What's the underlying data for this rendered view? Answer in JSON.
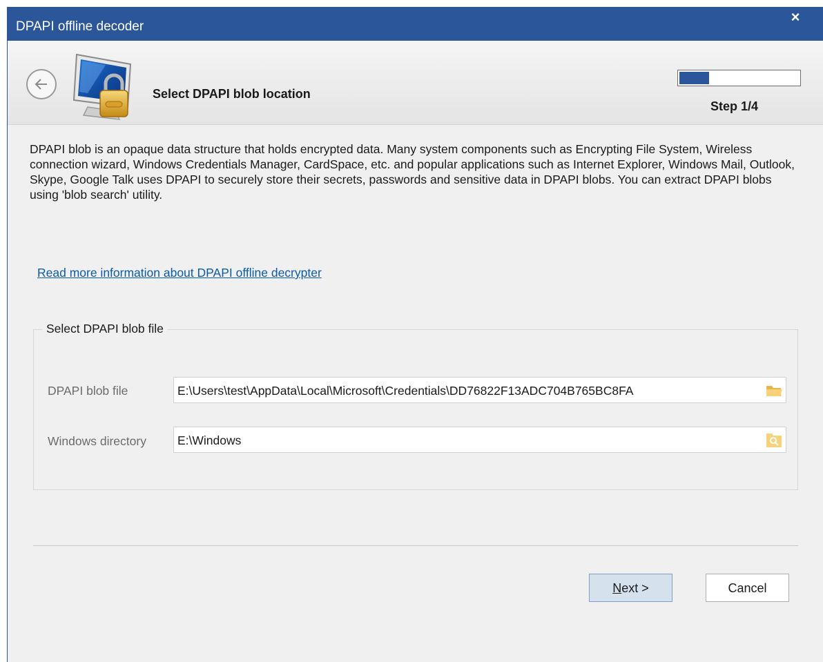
{
  "window": {
    "title": "DPAPI offline decoder",
    "close_label": "×"
  },
  "header": {
    "title": "Select DPAPI blob location",
    "step_label": "Step 1/4",
    "progress_fraction": 0.25,
    "icon": "monitor-lock-icon"
  },
  "description": "DPAPI blob is an opaque data structure that holds encrypted data. Many system components such as Encrypting File System, Wireless connection wizard, Windows Credentials Manager, CardSpace, etc. and popular applications such as Internet Explorer, Windows Mail, Outlook, Skype, Google Talk uses DPAPI to securely store their secrets, passwords and sensitive data in DPAPI blobs. You can extract DPAPI blobs using 'blob search' utility.",
  "info_link": "Read more information about DPAPI offline decrypter",
  "group": {
    "title": "Select DPAPI blob file",
    "fields": [
      {
        "label": "DPAPI blob file",
        "value": "E:\\Users\\test\\AppData\\Local\\Microsoft\\Credentials\\DD76822F13ADC704B765BC8FA",
        "icon": "folder-open-icon"
      },
      {
        "label": "Windows directory",
        "value": "E:\\Windows",
        "icon": "folder-search-icon"
      }
    ]
  },
  "buttons": {
    "next_mnemonic": "N",
    "next_rest": "ext >",
    "cancel": "Cancel"
  },
  "colors": {
    "accent": "#2b579a",
    "link": "#0b5aa8",
    "folder": "#f0c060"
  }
}
